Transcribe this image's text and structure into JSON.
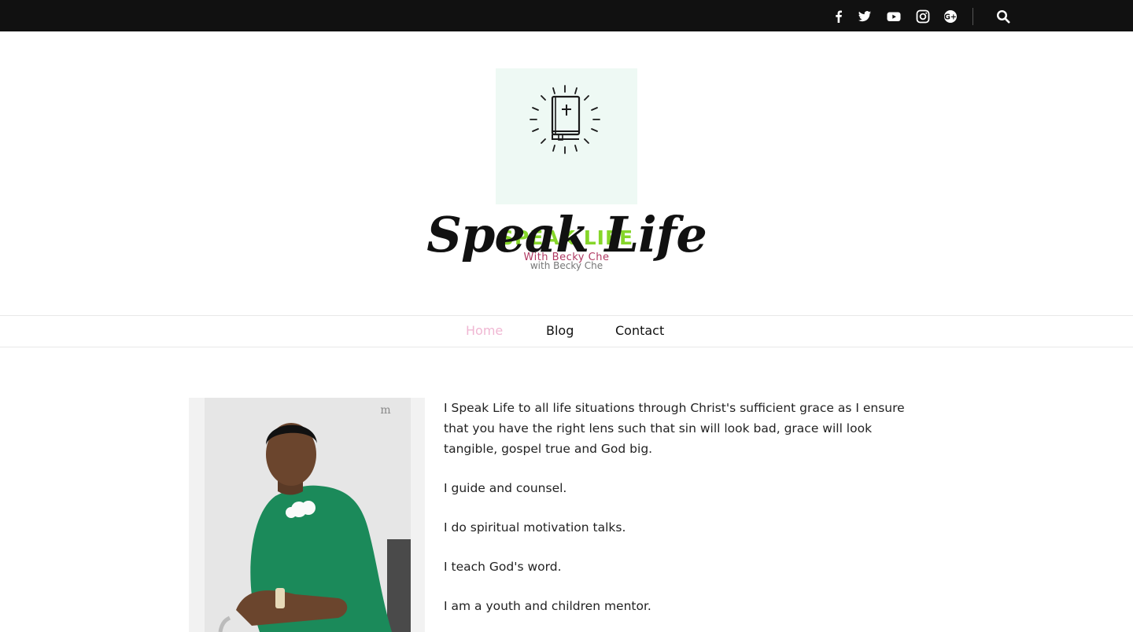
{
  "topbar": {
    "social": [
      {
        "name": "facebook-icon"
      },
      {
        "name": "twitter-icon"
      },
      {
        "name": "youtube-icon"
      },
      {
        "name": "instagram-icon"
      },
      {
        "name": "google-plus-icon"
      }
    ],
    "search_icon": "search-icon"
  },
  "header": {
    "logo_main": "SPEAK LIFE",
    "logo_sub": "With Becky Che",
    "title": "Speak Life",
    "tagline": "with Becky Che"
  },
  "nav": {
    "items": [
      {
        "label": "Home",
        "active": true
      },
      {
        "label": "Blog",
        "active": false
      },
      {
        "label": "Contact",
        "active": false
      }
    ]
  },
  "content": {
    "paragraphs": [
      "I Speak Life to all life situations through Christ's sufficient grace as I ensure that you have the right lens such that sin will look bad, grace will look tangible, gospel true and God big.",
      "I guide and counsel.",
      "I do spiritual motivation talks.",
      "I teach God's word.",
      "I am a youth and children mentor."
    ]
  },
  "colors": {
    "topbar": "#111111",
    "nav_active": "#f0b7d3",
    "logo_green": "#86d62a",
    "logo_pink": "#b03a63"
  }
}
